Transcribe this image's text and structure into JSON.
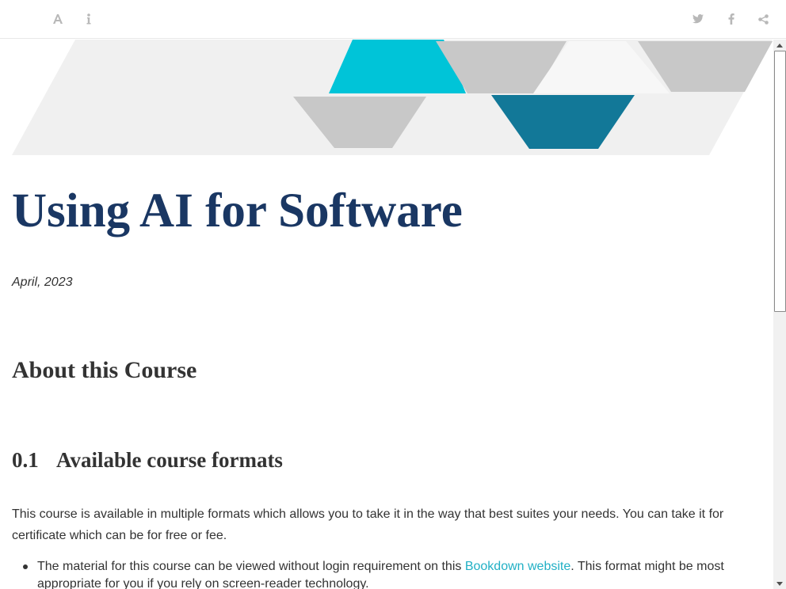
{
  "toolbar": {
    "left_icons": [
      "font-settings-icon",
      "info-icon"
    ],
    "right_icons": [
      "twitter-icon",
      "facebook-icon",
      "share-icon"
    ]
  },
  "page": {
    "title": "Using AI for Software",
    "date": "April, 2023"
  },
  "section": {
    "heading": "About this Course"
  },
  "subsection": {
    "number": "0.1",
    "heading": "Available course formats"
  },
  "body": {
    "paragraph": "This course is available in multiple formats which allows you to take it in the way that best suites your needs. You can take it for certificate which can be for free or fee.",
    "bullet1_before": "The material for this course can be viewed without login requirement on this ",
    "bullet1_link": "Bookdown website",
    "bullet1_after": ". This format might be most appropriate for you if you rely on screen-reader technology."
  },
  "colors": {
    "title": "#1a3763",
    "link": "#21b0c5",
    "banner_cyan": "#00c4d8",
    "banner_teal": "#127898",
    "banner_gray": "#c8c8c8",
    "banner_light": "#f0f0f0"
  }
}
